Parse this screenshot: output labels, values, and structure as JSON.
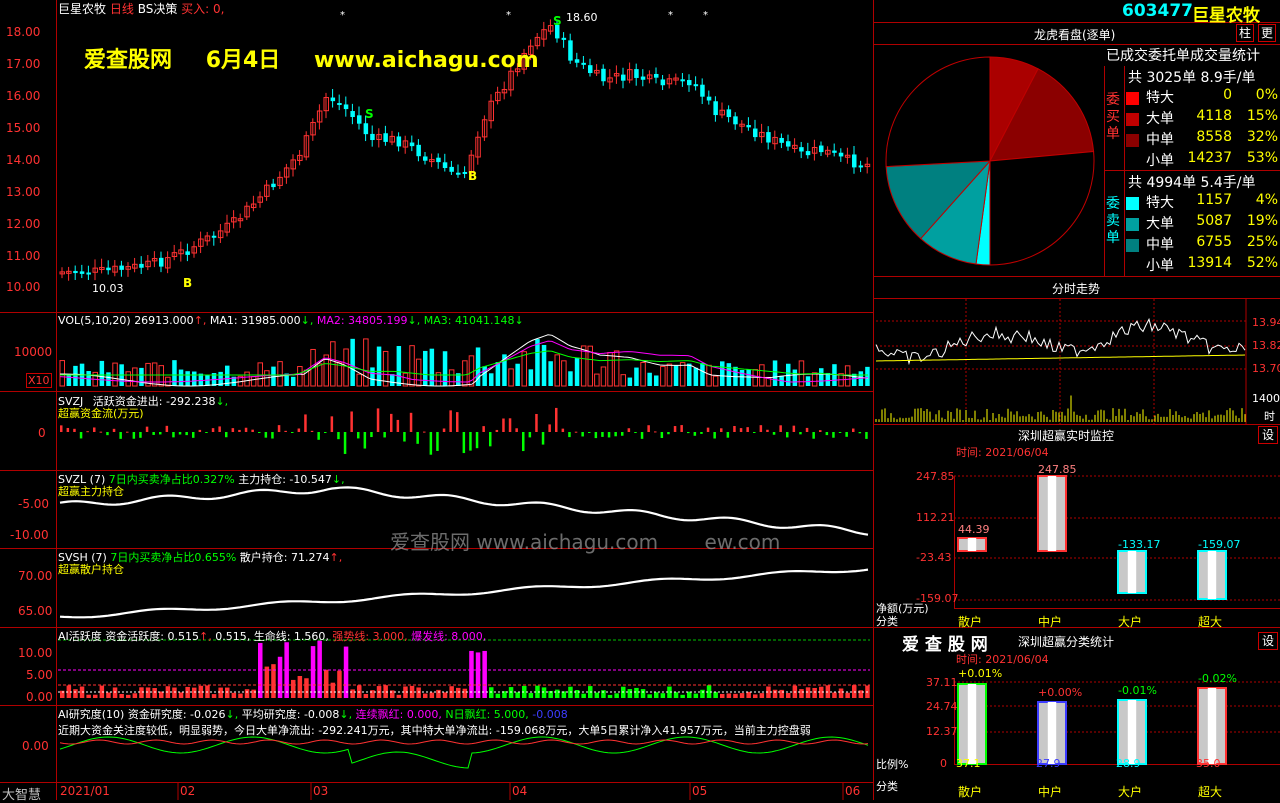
{
  "stock": {
    "code": "603477",
    "name": "巨星农牧",
    "period": "日线",
    "strategy": "BS决策",
    "buy_flag": "买入: 0,"
  },
  "watermark": {
    "site": "爱查股网",
    "date": "6月4日",
    "url": "www.aichagu.com",
    "center_text": "爱查股网  www.aichagu.com",
    "center_tail": "ew.com"
  },
  "main_chart": {
    "price_axis": [
      "18.00",
      "17.00",
      "16.00",
      "15.00",
      "14.00",
      "13.00",
      "12.00",
      "11.00",
      "10.00"
    ],
    "high_label": "18.60",
    "low_label": "10.03",
    "markers": {
      "b1": "B",
      "s1": "S",
      "b2": "B",
      "s2": "S"
    }
  },
  "vol": {
    "title": "VOL(5,10,20)",
    "val": "26913.000",
    "ma1": "MA1: 31985.000",
    "ma2": "MA2: 34805.199",
    "ma3": "MA3: 41041.148",
    "axis": "10000",
    "unit": "X10"
  },
  "svzj": {
    "title": "SVZJ",
    "label": "活跃资金进出: -292.238",
    "sub": "超赢资金流(万元)",
    "axis": "0"
  },
  "svzl": {
    "title": "SVZL (7)",
    "ratio": "7日内买卖净占比0.327%",
    "hold": "主力持仓: -10.547",
    "sub": "超赢主力持仓",
    "axis": [
      "-5.00",
      "-10.00"
    ]
  },
  "svsh": {
    "title": "SVSH (7)",
    "ratio": "7日内买卖净占比0.655%",
    "hold": "散户持仓: 71.274",
    "sub": "超赢散户持仓",
    "axis": [
      "70.00",
      "65.00"
    ]
  },
  "ai_active": {
    "title": "AI活跃度",
    "a": "资金活跃度: 0.515",
    "b": "0.515,",
    "c": "生命线: 1.560,",
    "d": "强势线: 3.000,",
    "e": "爆发线: 8.000,",
    "axis": [
      "10.00",
      "5.00",
      "0.00"
    ]
  },
  "ai_research": {
    "title": "AI研究度(10)",
    "a": "资金研究度: -0.026",
    "b": "平均研究度: -0.008",
    "c": "连续飘红: 0.000,",
    "d": "N日飘红: 5.000,",
    "e": "-0.008",
    "axis": "0.00",
    "comment": "近期大资金关注度较低，明显弱势，今日大单净流出: -292.241万元，其中特大单净流出: -159.068万元，大单5日累计净入41.957万元，当前主力控盘弱"
  },
  "bottom": {
    "brand": "大智慧",
    "dates": [
      "2021/01",
      "02",
      "03",
      "04",
      "05",
      "06"
    ]
  },
  "right": {
    "code": "603477",
    "name": "巨星农牧",
    "btn_zhu": "柱",
    "btn_more": "更",
    "lhk_title": "龙虎看盘(逐单)",
    "deal_title": "已成交委托单成交量统计",
    "buy": {
      "side": "委买单",
      "total": "共 3025单 8.9手/单",
      "rows": [
        {
          "n": "特大",
          "v": "0",
          "p": "0%",
          "c": "#ff0000"
        },
        {
          "n": "大单",
          "v": "4118",
          "p": "15%",
          "c": "#c00000"
        },
        {
          "n": "中单",
          "v": "8558",
          "p": "32%",
          "c": "#8b0000"
        },
        {
          "n": "小单",
          "v": "14237",
          "p": "53%",
          "c": "#000000"
        }
      ]
    },
    "sell": {
      "side": "委卖单",
      "total": "共 4994单 5.4手/单",
      "rows": [
        {
          "n": "特大",
          "v": "1157",
          "p": "4%",
          "c": "#00ffff"
        },
        {
          "n": "大单",
          "v": "5087",
          "p": "19%",
          "c": "#00a0a0"
        },
        {
          "n": "中单",
          "v": "6755",
          "p": "25%",
          "c": "#008080"
        },
        {
          "n": "小单",
          "v": "13914",
          "p": "52%",
          "c": "#000000"
        }
      ]
    },
    "pie": {
      "slices": [
        {
          "label": "买特大",
          "value": 0,
          "color": "#ff0000"
        },
        {
          "label": "买大单",
          "value": 4118,
          "color": "#aa0000"
        },
        {
          "label": "买中单",
          "value": 8558,
          "color": "#8b0000"
        },
        {
          "label": "买小单",
          "value": 14237,
          "color": "#000000"
        },
        {
          "label": "卖特大",
          "value": 1157,
          "color": "#00ffff"
        },
        {
          "label": "卖大单",
          "value": 5087,
          "color": "#00a0a0"
        },
        {
          "label": "卖中单",
          "value": 6755,
          "color": "#008080"
        },
        {
          "label": "卖小单",
          "value": 13914,
          "color": "#000000"
        }
      ]
    },
    "intraday": {
      "title": "分时走势",
      "axis": [
        "13.94",
        "13.82",
        "13.70"
      ],
      "vol_axis": "1400",
      "unit": "时"
    },
    "realtime": {
      "title": "深圳超赢实时监控",
      "btn": "设",
      "time": "时间: 2021/06/04",
      "axis": [
        "247.85",
        "112.21",
        "-23.43",
        "-159.07"
      ],
      "ylabel": "净额(万元)",
      "xlabel": "分类",
      "values": [
        "44.39",
        "247.85",
        "-133.17",
        "-159.07"
      ],
      "cats": [
        "散户",
        "中户",
        "大户",
        "超大"
      ]
    },
    "classify": {
      "brand": "爱 查 股 网",
      "title": "深圳超赢分类统计",
      "btn": "设",
      "time": "时间: 2021/06/04",
      "axis": [
        "37.11",
        "24.74",
        "12.37",
        "0"
      ],
      "ylabel": "比例%",
      "xlabel": "分类",
      "pct": [
        "+0.01%",
        "+0.00%",
        "-0.01%",
        "-0.02%"
      ],
      "vals": [
        "37.1",
        "27.9",
        "28.9",
        "35.0"
      ],
      "cats": [
        "散户",
        "中户",
        "大户",
        "超大"
      ]
    }
  }
}
